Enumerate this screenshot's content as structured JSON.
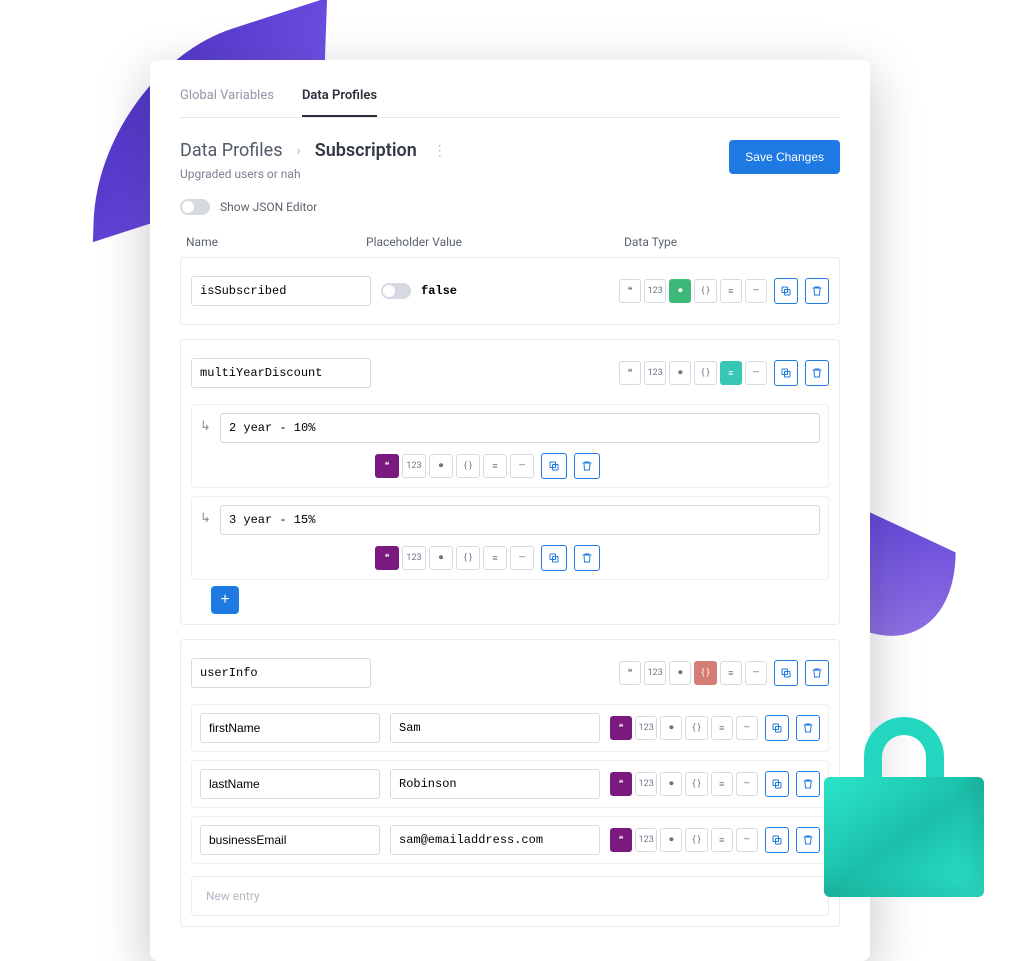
{
  "tabs": {
    "global": "Global Variables",
    "profiles": "Data Profiles"
  },
  "header": {
    "crumb1": "Data Profiles",
    "title": "Subscription",
    "subtitle": "Upgraded users or nah",
    "save": "Save Changes"
  },
  "json_toggle_label": "Show JSON Editor",
  "cols": {
    "name": "Name",
    "ph": "Placeholder Value",
    "dt": "Data Type"
  },
  "rows": {
    "r1": {
      "name": "isSubscribed",
      "bool": "false"
    },
    "r2": {
      "name": "multiYearDiscount",
      "c1": "2 year - 10%",
      "c2": "3 year - 15%"
    },
    "r3": {
      "name": "userInfo",
      "f1": {
        "name": "firstName",
        "val": "Sam"
      },
      "f2": {
        "name": "lastName",
        "val": "Robinson"
      },
      "f3": {
        "name": "businessEmail",
        "val": "sam@emailaddress.com"
      }
    }
  },
  "newentry": "New entry",
  "pills": {
    "quote": "❝",
    "num": "123",
    "tog": "⏺",
    "brace": "{ }",
    "list": "≡",
    "dash": "—"
  }
}
